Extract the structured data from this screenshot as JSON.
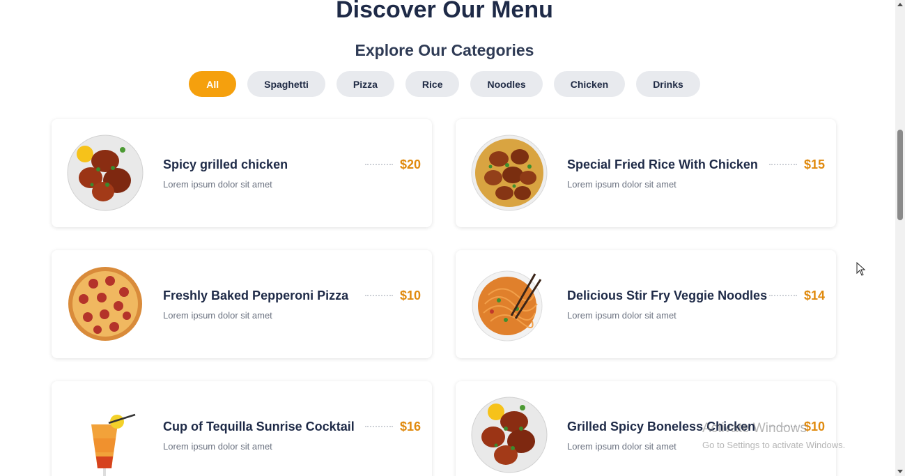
{
  "header": {
    "title": "Discover Our Menu",
    "subtitle": "Explore Our Categories"
  },
  "categories": [
    {
      "label": "All",
      "active": true
    },
    {
      "label": "Spaghetti",
      "active": false
    },
    {
      "label": "Pizza",
      "active": false
    },
    {
      "label": "Rice",
      "active": false
    },
    {
      "label": "Noodles",
      "active": false
    },
    {
      "label": "Chicken",
      "active": false
    },
    {
      "label": "Drinks",
      "active": false
    }
  ],
  "menu_items": [
    {
      "name": "Spicy grilled chicken",
      "description": "Lorem ipsum dolor sit amet",
      "price": "$20",
      "image": "grilled-chicken-plate-image"
    },
    {
      "name": "Special Fried Rice With Chicken",
      "description": "Lorem ipsum dolor sit amet",
      "price": "$15",
      "image": "fried-rice-chicken-image"
    },
    {
      "name": "Freshly Baked Pepperoni Pizza",
      "description": "Lorem ipsum dolor sit amet",
      "price": "$10",
      "image": "pepperoni-pizza-image"
    },
    {
      "name": "Delicious Stir Fry Veggie Noodles",
      "description": "Lorem ipsum dolor sit amet",
      "price": "$14",
      "image": "veggie-noodles-image"
    },
    {
      "name": "Cup of Tequilla Sunrise Cocktail",
      "description": "Lorem ipsum dolor sit amet",
      "price": "$16",
      "image": "tequila-sunrise-cocktail-image"
    },
    {
      "name": "Grilled Spicy Boneless Chicken",
      "description": "Lorem ipsum dolor sit amet",
      "price": "$10",
      "image": "boneless-chicken-plate-image"
    }
  ],
  "overlay": {
    "watermark_line1": "Activate Windows",
    "watermark_line2": "Go to Settings to activate Windows."
  },
  "colors": {
    "accent": "#f5a00d",
    "price": "#e08a0e",
    "title": "#1e2a47",
    "chip_bg": "#e8eaee"
  }
}
